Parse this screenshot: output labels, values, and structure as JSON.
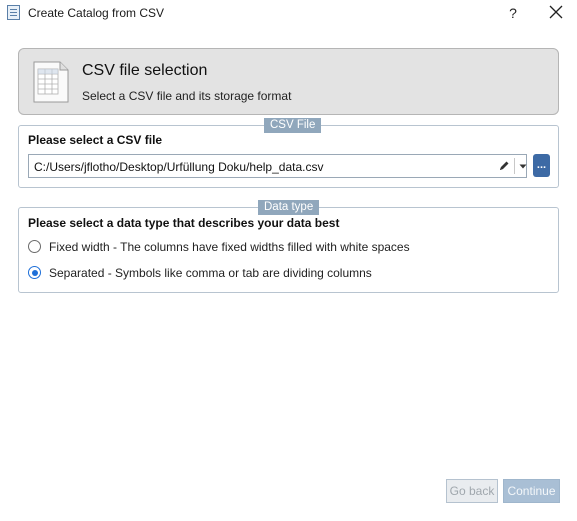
{
  "window": {
    "title": "Create Catalog from CSV",
    "help_label": "?"
  },
  "header": {
    "title": "CSV file selection",
    "subtitle": "Select a CSV file and its storage format"
  },
  "csv_file_group": {
    "tag": "CSV File",
    "heading": "Please select a CSV file",
    "path_value": "C:/Users/jflotho/Desktop/Urfüllung Doku/help_data.csv",
    "browse_label": "..."
  },
  "data_type_group": {
    "tag": "Data type",
    "heading": "Please select a data type that describes your data best",
    "options": [
      {
        "label": "Fixed width - The columns have fixed widths filled with white spaces",
        "selected": false
      },
      {
        "label": "Separated - Symbols like comma or tab are dividing columns",
        "selected": true
      }
    ]
  },
  "footer": {
    "back_label": "Go back",
    "continue_label": "Continue"
  },
  "colors": {
    "accent": "#3d6aa5",
    "group_tag": "#90a7bc",
    "radio_selected": "#1e6fd8"
  },
  "icons": {
    "app": "app-icon",
    "close": "close-icon",
    "header": "csv-document-icon",
    "edit": "pencil-icon",
    "dropdown": "chevron-down-icon"
  }
}
